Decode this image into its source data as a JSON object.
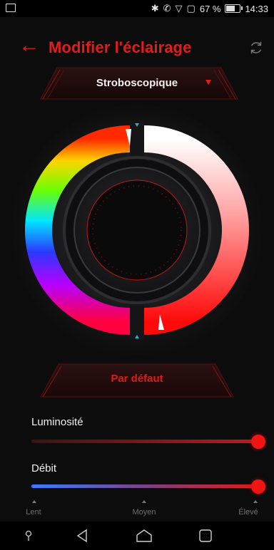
{
  "status_bar": {
    "battery_text": "67 %",
    "battery_level": 0.67,
    "time": "14:33",
    "icons": [
      "gallery-icon",
      "bluetooth-icon",
      "call-icon",
      "wifi-icon",
      "notification-icon",
      "battery-icon"
    ]
  },
  "header": {
    "title": "Modifier l'éclairage",
    "back_icon": "arrow-left-icon",
    "reset_icon": "refresh-icon"
  },
  "mode": {
    "selected": "Stroboscopique",
    "dropdown_icon": "caret-down-icon"
  },
  "color_wheel": {
    "selected_color": "#ff2b2b",
    "accent": "#e31b1b"
  },
  "default_button": {
    "label": "Par défaut"
  },
  "brightness": {
    "label": "Luminosité",
    "value": 1.0
  },
  "rate": {
    "label": "Débit",
    "value": 1.0,
    "ticks": [
      "Lent",
      "Moyen",
      "Élevé"
    ]
  },
  "nav_bar": {
    "icons": [
      "pin-icon",
      "back-icon",
      "home-icon",
      "recents-icon"
    ]
  }
}
